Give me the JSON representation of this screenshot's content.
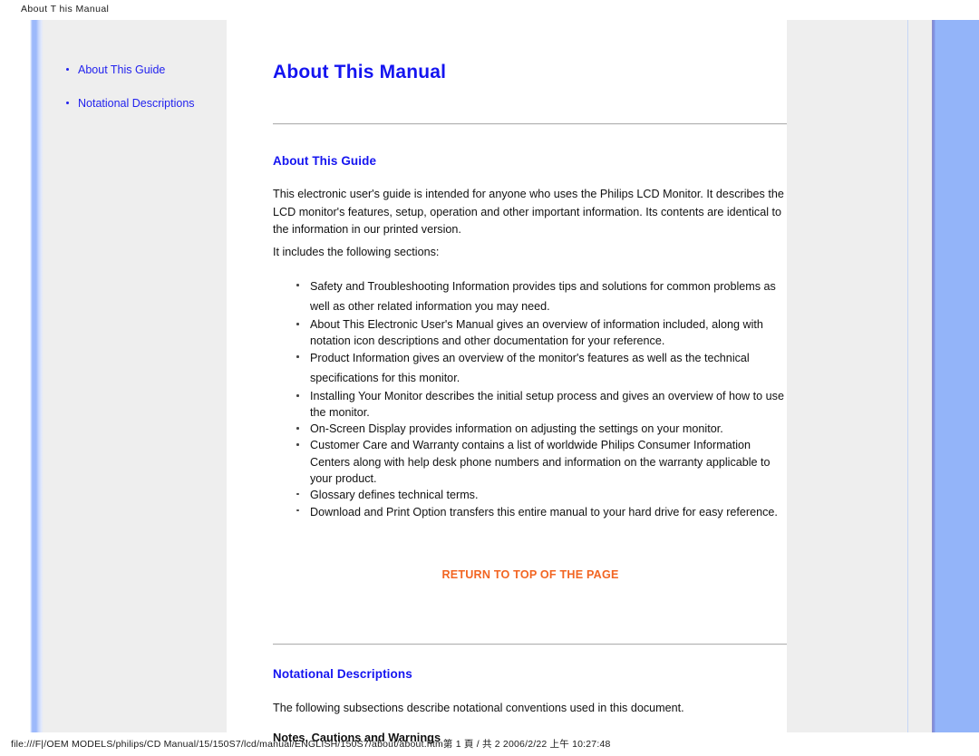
{
  "print": {
    "header": "About T his Manual",
    "footer": "file:///F|/OEM MODELS/philips/CD Manual/15/150S7/lcd/manual/ENGLISH/150S7/about/about.htm第 1 頁 / 共 2 2006/2/22 上午 10:27:48"
  },
  "colors": {
    "heading_blue": "#1414f0",
    "link_blue": "#3333ee",
    "sidebar_link_blue": "#2222ee",
    "return_orange": "#f26522",
    "panel_gray": "#eeeeee",
    "rail_blue": "#93b4f9",
    "body_text": "#111111"
  },
  "sidebar": {
    "items": [
      {
        "label": "About This Guide"
      },
      {
        "label": "Notational Descriptions"
      }
    ]
  },
  "main": {
    "title": "About This Manual",
    "sections": [
      {
        "heading": "About This Guide",
        "intro_paragraph": "This electronic user's guide is intended for anyone who uses the Philips LCD Monitor. It describes the LCD monitor's features, setup, operation and other important information. Its contents are identical to the information in our printed version.",
        "includes_line": "It includes the following sections:"
      }
    ],
    "bullets": [
      {
        "link": "Safety and Troubleshooting Information",
        "text": " provides tips and solutions for common problems as well as other related information you may need.",
        "spaced": true
      },
      {
        "link": "",
        "text": "About This Electronic User's Manual gives an overview of information included, along with notation icon descriptions and other documentation for your reference.",
        "spaced": false
      },
      {
        "link": "Product Information",
        "text": " gives an overview of the monitor's features as well as the technical specifications for this monitor.",
        "spaced": true
      },
      {
        "link": "Installing Your Monitor",
        "text": " describes the initial setup process and gives an overview of how to use the monitor.",
        "spaced": false
      },
      {
        "link": "On-Screen Display",
        "text": " provides information on adjusting the settings on your monitor.",
        "spaced": false
      },
      {
        "link": "Customer Care and Warranty",
        "text": " contains a list of worldwide Philips Consumer Information Centers along with help desk phone numbers and information on the warranty applicable to your product.",
        "spaced": false
      },
      {
        "link": "Glossary",
        "text": " defines technical terms.",
        "spaced": false
      },
      {
        "link": "Download and Print Option",
        "text": " transfers this entire manual to your hard drive for easy reference.",
        "spaced": true
      }
    ],
    "return_to_top": "RETURN TO TOP OF THE PAGE",
    "notational": {
      "heading": "Notational Descriptions",
      "paragraph": "The following subsections describe notational conventions used in this document.",
      "sub_heading": "Notes, Cautions and Warnings"
    }
  }
}
